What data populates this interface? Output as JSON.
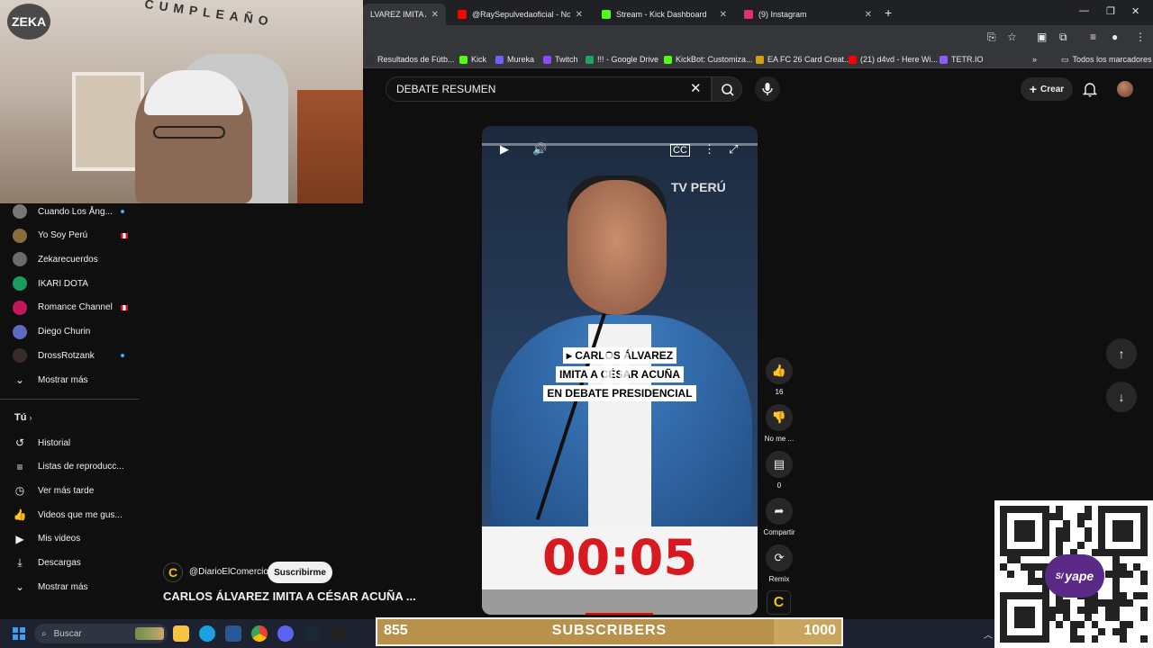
{
  "browser": {
    "tabs": [
      {
        "title": "LVAREZ IMITA A",
        "color": "#ff0000",
        "active": true
      },
      {
        "title": "@RaySepulvedaoficial - No Vale",
        "color": "#ff0000"
      },
      {
        "title": "Stream - Kick Dashboard",
        "color": "#53fc18"
      },
      {
        "title": "(9) Instagram",
        "color": "#e1306c"
      }
    ],
    "bookmarks": [
      {
        "label": "Resultados de Fútb...",
        "color": "#333333"
      },
      {
        "label": "Kick",
        "color": "#53fc18"
      },
      {
        "label": "Mureka",
        "color": "#6c63ff"
      },
      {
        "label": "Twitch",
        "color": "#9146ff"
      },
      {
        "label": "!!! - Google Drive",
        "color": "#1fa463"
      },
      {
        "label": "KickBot: Customiza...",
        "color": "#53fc18"
      },
      {
        "label": "EA FC 26 Card Creat...",
        "color": "#d4a017"
      },
      {
        "label": "(21) d4vd - Here Wi...",
        "color": "#ff0000"
      },
      {
        "label": "TETR.IO",
        "color": "#8b5cf6"
      }
    ],
    "all_bookmarks": "Todos los marcadores"
  },
  "search": {
    "query": "DEBATE RESUMEN"
  },
  "header": {
    "create_label": "Crear"
  },
  "webcam": {
    "logo": "ZEKA",
    "banner": "CUMPLEAÑO"
  },
  "sidebar": {
    "subscriptions": [
      {
        "label": "Cuando Los Ång...",
        "color": "#777777",
        "marker": "dot"
      },
      {
        "label": "Yo Soy Perú",
        "color": "#8a6d3b",
        "marker": "flag"
      },
      {
        "label": "Zekarecuerdos",
        "color": "#6b6b6b",
        "marker": ""
      },
      {
        "label": "IKARI DOTA",
        "color": "#1a9e5c",
        "marker": ""
      },
      {
        "label": "Romance Channel",
        "color": "#c2185b",
        "marker": "flag"
      },
      {
        "label": "Diego Churin",
        "color": "#5c6bc0",
        "marker": ""
      },
      {
        "label": "DrossRotzank",
        "color": "#3a2a2a",
        "marker": "dot"
      }
    ],
    "show_more_1": "Mostrar más",
    "you_label": "Tú",
    "you_items": [
      {
        "label": "Historial",
        "icon": "history-icon",
        "glyph": "↺"
      },
      {
        "label": "Listas de reproducc...",
        "icon": "playlist-icon",
        "glyph": "≡"
      },
      {
        "label": "Ver más tarde",
        "icon": "clock-icon",
        "glyph": "◷"
      },
      {
        "label": "Videos que me gus...",
        "icon": "thumbs-up-icon",
        "glyph": "👍"
      },
      {
        "label": "Mis videos",
        "icon": "my-videos-icon",
        "glyph": "▶"
      },
      {
        "label": "Descargas",
        "icon": "download-icon",
        "glyph": "⤓"
      }
    ],
    "show_more_2": "Mostrar más"
  },
  "video": {
    "watermark": "TV PERÚ",
    "caption_lines": [
      "▸ CARLOS ÁLVAREZ",
      "IMITA A CÉSAR ACUÑA",
      "EN DEBATE PRESIDENCIAL"
    ],
    "timer": "00:05",
    "progress": 0
  },
  "actions": {
    "likes": "16",
    "dislike_label": "No me ...",
    "comments": "0",
    "share_label": "Compartir",
    "remix_label": "Remix"
  },
  "channel": {
    "logo": "C",
    "name": "@DiarioElComercio",
    "subscribe_label": "Suscribirme",
    "video_title": "CARLOS ÁLVAREZ IMITA A CÉSAR ACUÑA ..."
  },
  "taskbar": {
    "search_placeholder": "Buscar"
  },
  "sub_goal": {
    "current": "855",
    "label": "SUBSCRIBERS",
    "goal": "1000",
    "fraction": 0.855
  },
  "qr": {
    "brand": "yape",
    "symbol": "S/"
  }
}
